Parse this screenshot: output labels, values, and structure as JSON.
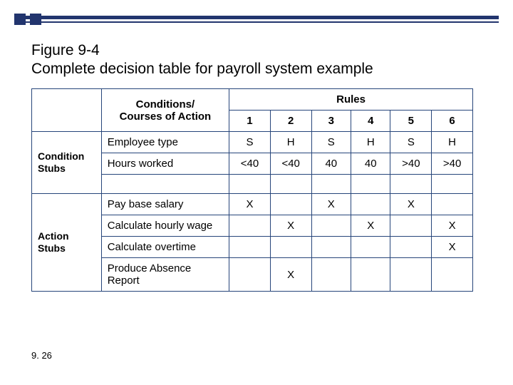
{
  "figure": {
    "number": "Figure 9-4",
    "title": "Complete decision table for payroll system example"
  },
  "headers": {
    "stubs_condition": "Condition Stubs",
    "stubs_action": "Action Stubs",
    "conditions_label": "Conditions/\nCourses of Action",
    "rules_label": "Rules",
    "rule_nums": [
      "1",
      "2",
      "3",
      "4",
      "5",
      "6"
    ]
  },
  "conditions": [
    {
      "label": "Employee type",
      "values": [
        "S",
        "H",
        "S",
        "H",
        "S",
        "H"
      ]
    },
    {
      "label": "Hours worked",
      "values": [
        "<40",
        "<40",
        "40",
        "40",
        ">40",
        ">40"
      ]
    }
  ],
  "actions": [
    {
      "label": "Pay base salary",
      "values": [
        "X",
        "",
        "X",
        "",
        "X",
        ""
      ]
    },
    {
      "label": "Calculate hourly wage",
      "values": [
        "",
        "X",
        "",
        "X",
        "",
        "X"
      ]
    },
    {
      "label": "Calculate overtime",
      "values": [
        "",
        "",
        "",
        "",
        "",
        "X"
      ]
    },
    {
      "label": "Produce Absence Report",
      "values": [
        "",
        "X",
        "",
        "",
        "",
        ""
      ]
    }
  ],
  "page_number": "9. 26"
}
